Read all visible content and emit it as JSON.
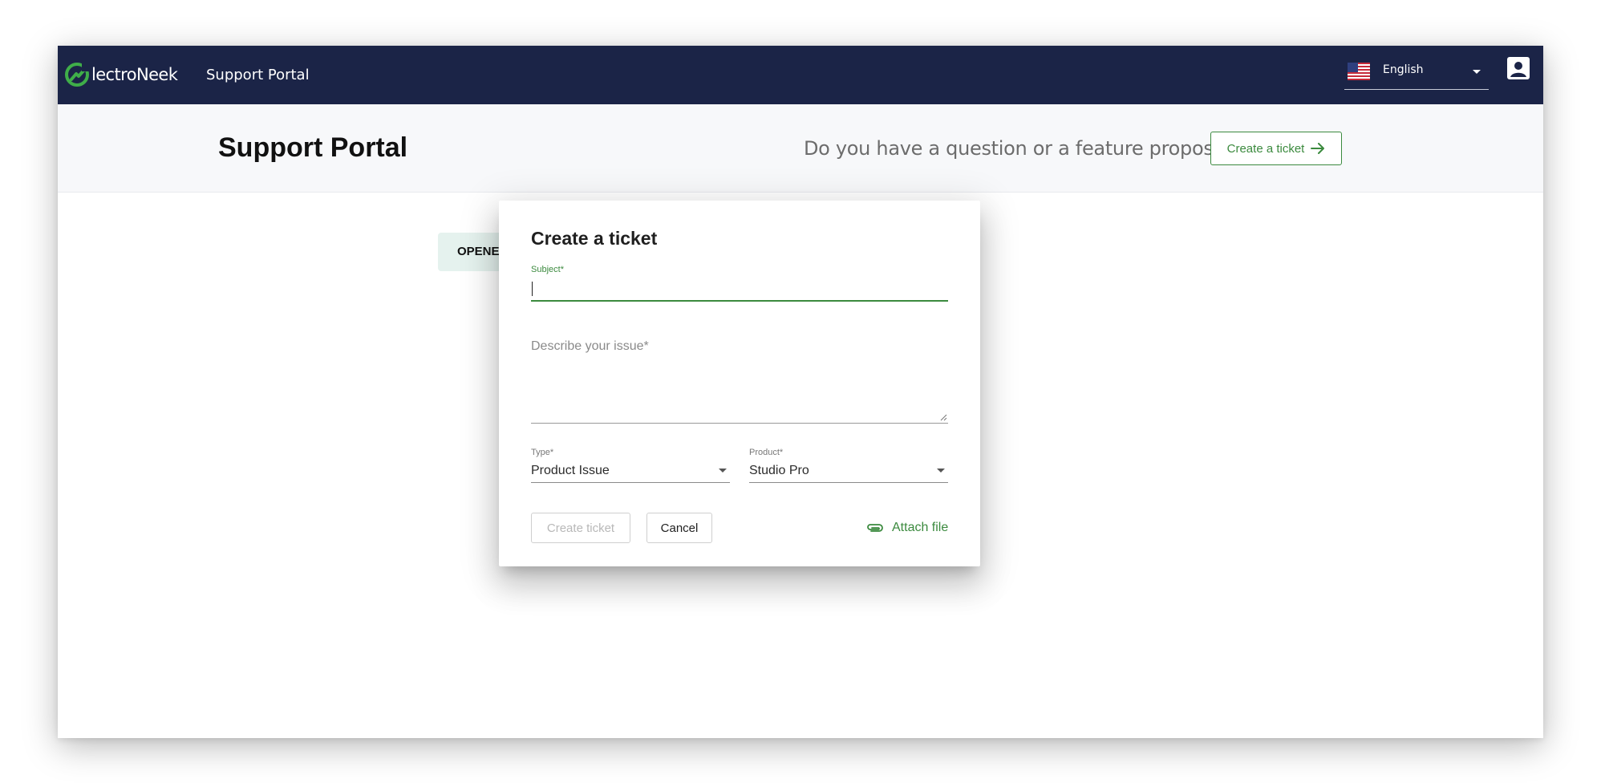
{
  "topbar": {
    "logo_text": "lectroNeek",
    "title": "Support Portal",
    "language": "English",
    "icons": {
      "logo": "electroneek-logo-icon",
      "flag": "us-flag-icon",
      "account": "account-box-icon"
    },
    "colors": {
      "background": "#1b2447",
      "logo_accent": "#3fae49"
    }
  },
  "hero": {
    "title": "Support Portal",
    "question": "Do you have a question or a feature proposal?",
    "create_button": "Create a ticket",
    "colors": {
      "accent": "#3b8a3e"
    }
  },
  "tabs": {
    "opened_label": "OPENED"
  },
  "modal": {
    "title": "Create a ticket",
    "subject_label": "Subject*",
    "subject_value": "",
    "describe_label": "Describe your issue*",
    "type_label": "Type*",
    "type_value": "Product Issue",
    "product_label": "Product*",
    "product_value": "Studio Pro",
    "create_button": "Create ticket",
    "cancel_button": "Cancel",
    "attach_label": "Attach file"
  }
}
